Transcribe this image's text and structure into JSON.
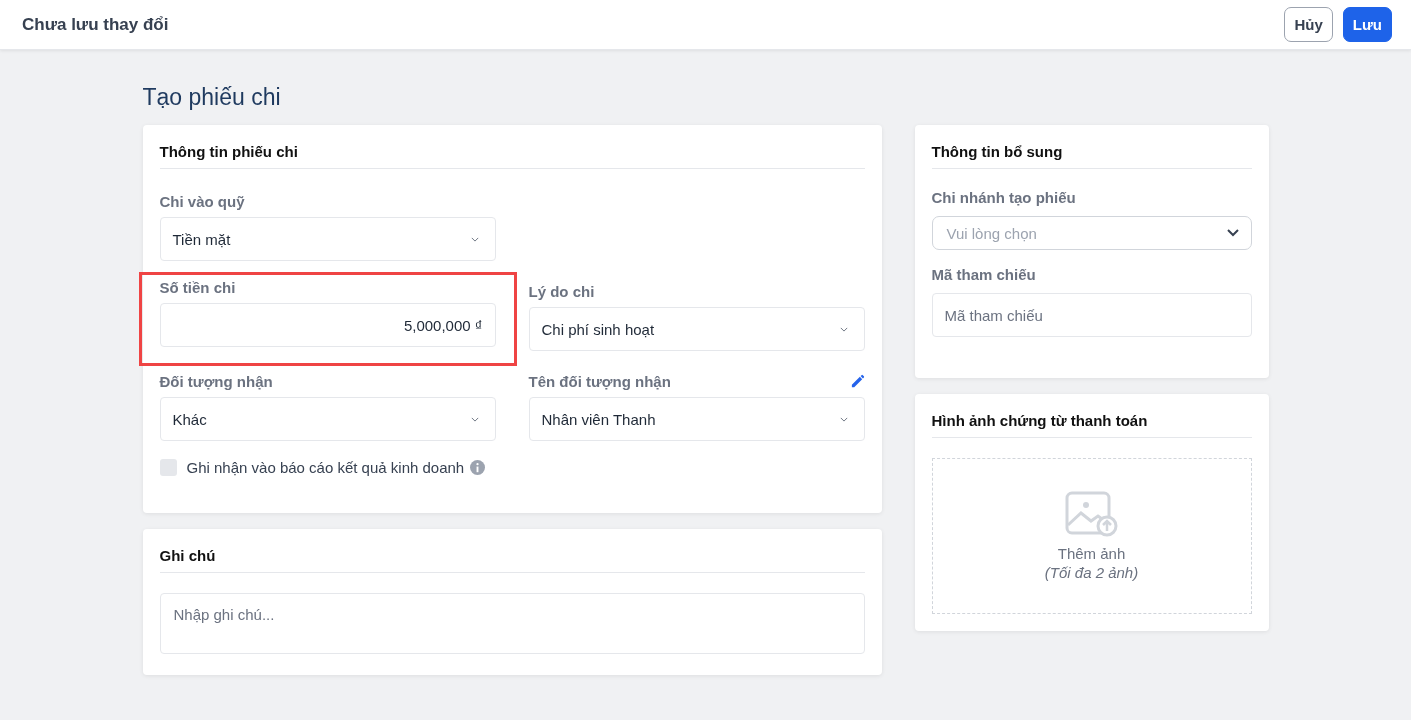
{
  "header": {
    "title": "Chưa lưu thay đổi",
    "buttons": [
      {
        "label": "Hủy",
        "kind": "secondary"
      },
      {
        "label": "Lưu",
        "kind": "primary"
      }
    ]
  },
  "page_title": "Tạo phiếu chi",
  "main_card": {
    "title": "Thông tin phiếu chi",
    "rows": [
      [
        {
          "label": "Chi vào quỹ",
          "kind": "select",
          "value": "Tiền mặt",
          "highlighted": false
        }
      ],
      [
        {
          "label": "Số tiền chi",
          "kind": "amount",
          "value": "5,000,000 ₫",
          "highlighted": true
        },
        {
          "label": "Lý do chi",
          "kind": "select",
          "value": "Chi phí sinh hoạt",
          "highlighted": false
        }
      ],
      [
        {
          "label": "Đối tượng nhận",
          "kind": "select",
          "value": "Khác",
          "highlighted": false
        },
        {
          "label": "Tên đối tượng nhận",
          "kind": "select",
          "value": "Nhân viên Thanh",
          "highlighted": false,
          "editable": true
        }
      ]
    ],
    "checkbox": {
      "label": "Ghi nhận vào báo cáo kết quả kinh doanh",
      "checked": false
    }
  },
  "note_card": {
    "title": "Ghi chú",
    "placeholder": "Nhập ghi chú..."
  },
  "extra_card": {
    "title": "Thông tin bổ sung",
    "fields": [
      {
        "label": "Chi nhánh tạo phiếu",
        "kind": "dropdown",
        "placeholder": "Vui lòng chọn"
      },
      {
        "label": "Mã tham chiếu",
        "kind": "text",
        "placeholder": "Mã tham chiếu"
      }
    ]
  },
  "image_card": {
    "title": "Hình ảnh chứng từ thanh toán",
    "upload_label": "Thêm ảnh",
    "upload_hint": "(Tối đa 2 ảnh)"
  }
}
